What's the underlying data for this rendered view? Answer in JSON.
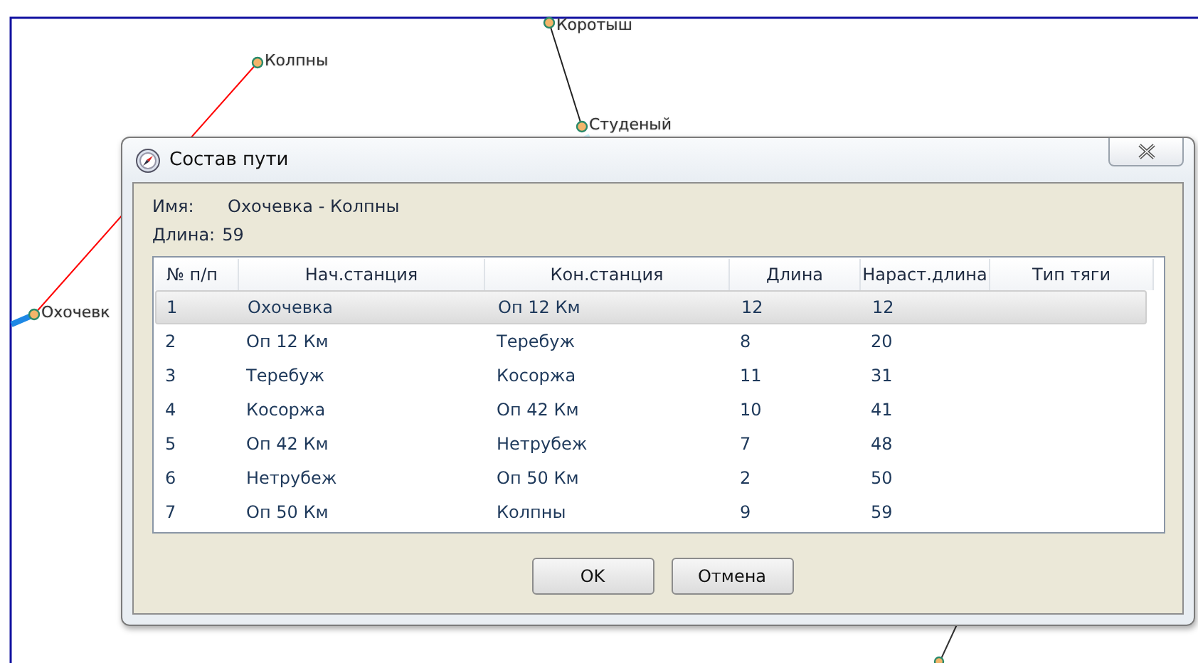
{
  "map": {
    "stations": [
      {
        "label": "Коротыш"
      },
      {
        "label": "Колпны"
      },
      {
        "label": "Студеный"
      },
      {
        "label": "Охочевк"
      }
    ],
    "edges": [
      {
        "color": "#ff0000"
      },
      {
        "color": "#222222"
      }
    ]
  },
  "dialog": {
    "title": "Состав пути",
    "fields": [
      {
        "label": "Имя:",
        "value": "Охочевка - Колпны"
      },
      {
        "label": "Длина:",
        "value": "59"
      }
    ],
    "table": {
      "columns": [
        "№ п/п",
        "Нач.станция",
        "Кон.станция",
        "Длина",
        "Нараст.длина",
        "Тип тяги"
      ],
      "rows": [
        {
          "cells": [
            "1",
            "Охочевка",
            "Оп 12 Км",
            "12",
            "12"
          ],
          "selected": true
        },
        {
          "cells": [
            "2",
            "Оп 12 Км",
            "Теребуж",
            "8",
            "20"
          ],
          "selected": false
        },
        {
          "cells": [
            "3",
            "Теребуж",
            "Косоржа",
            "11",
            "31"
          ],
          "selected": false
        },
        {
          "cells": [
            "4",
            "Косоржа",
            "Оп 42 Км",
            "10",
            "41"
          ],
          "selected": false
        },
        {
          "cells": [
            "5",
            "Оп 42 Км",
            "Нетрубеж",
            "7",
            "48"
          ],
          "selected": false
        },
        {
          "cells": [
            "6",
            "Нетрубеж",
            "Оп 50 Км",
            "2",
            "50"
          ],
          "selected": false
        },
        {
          "cells": [
            "7",
            "Оп 50 Км",
            "Колпны",
            "9",
            "59"
          ],
          "selected": false
        }
      ]
    },
    "buttons": [
      "OK",
      "Отмена"
    ]
  }
}
